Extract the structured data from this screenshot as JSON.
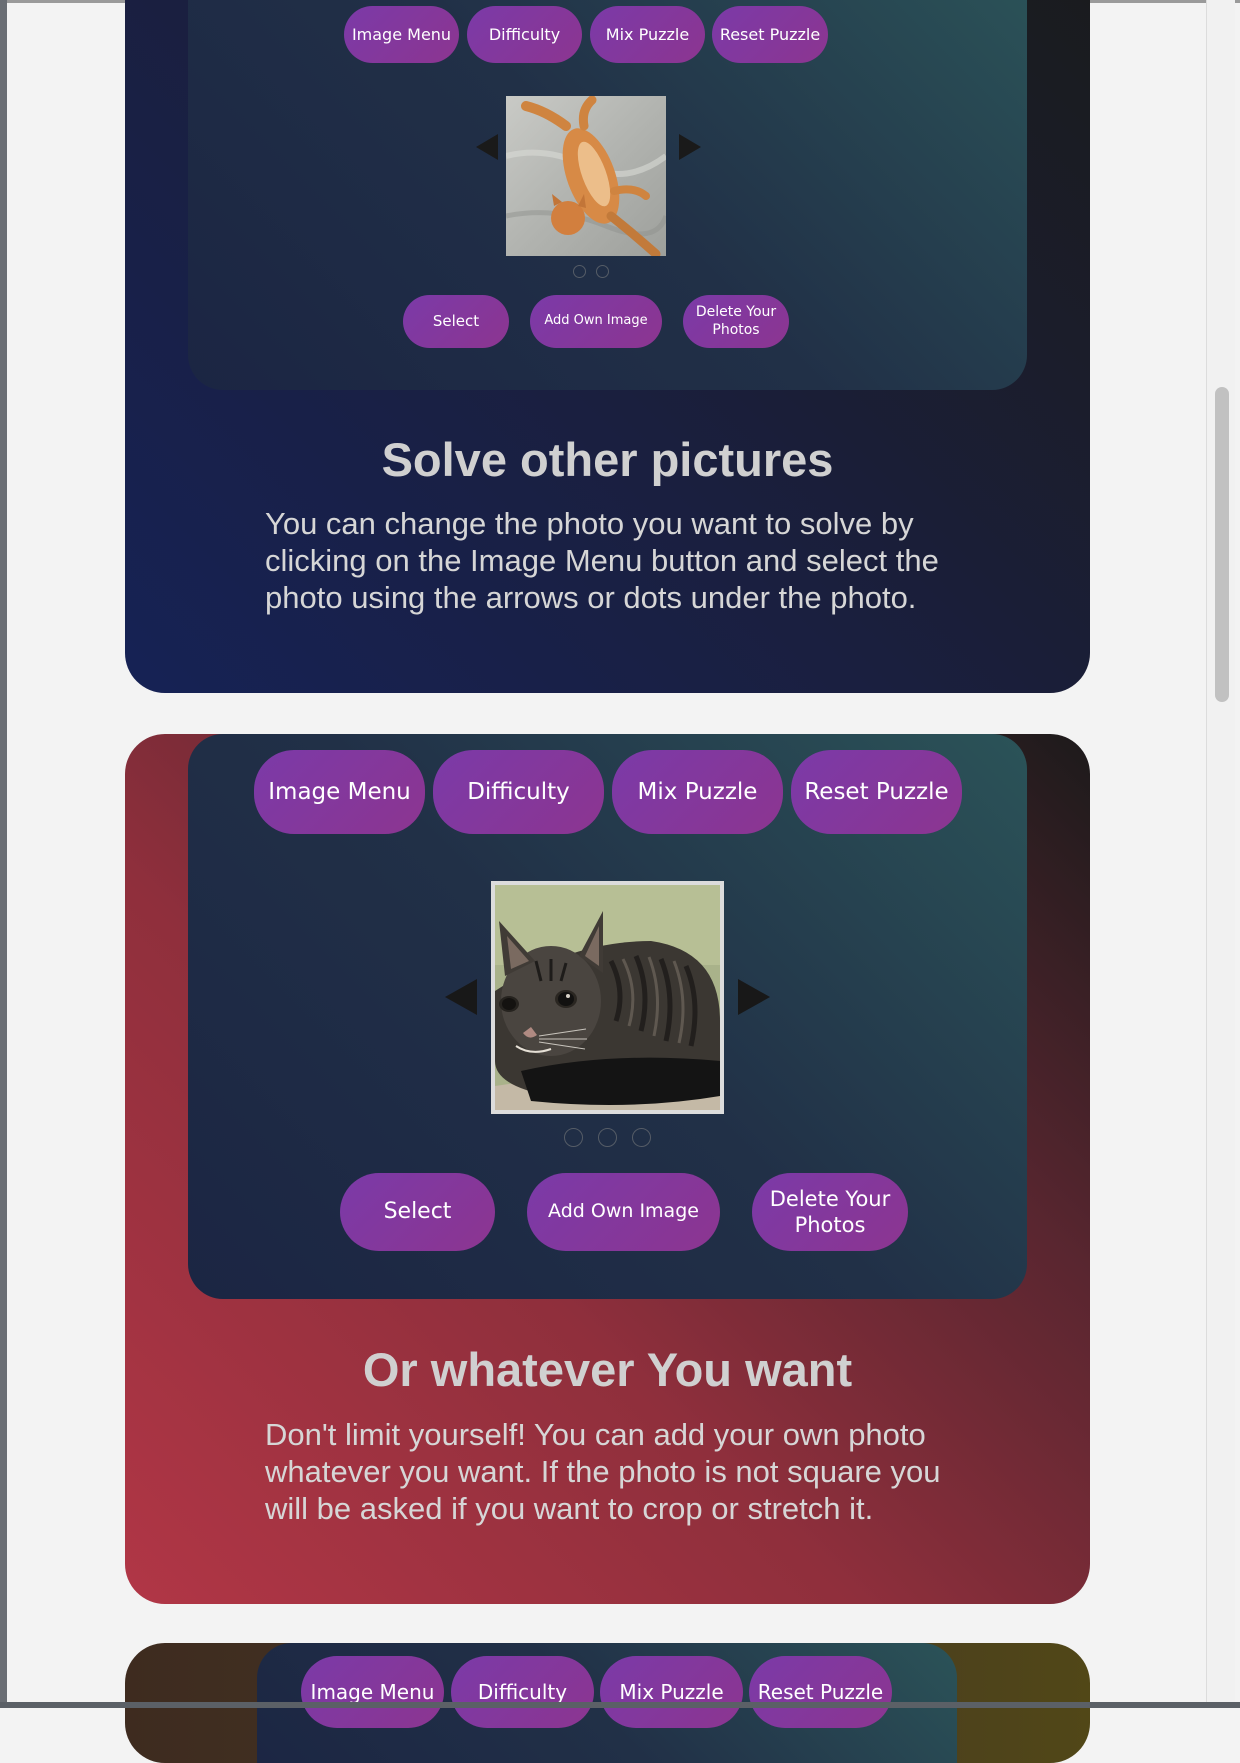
{
  "colors": {
    "page_background": "#f3f3f3",
    "button": "#8a3599",
    "heading_text": "#d0d0d0"
  },
  "toolbar": {
    "image_menu": "Image Menu",
    "difficulty": "Difficulty",
    "mix_puzzle": "Mix Puzzle",
    "reset_puzzle": "Reset Puzzle"
  },
  "image_menu": {
    "select": "Select",
    "add_own_image": "Add Own Image",
    "delete_line1": "Delete Your",
    "delete_line2": "Photos"
  },
  "sections": [
    {
      "title": "Solve other pictures",
      "text": "You can change the photo you want to solve by clicking on the Image Menu button and select the photo using the arrows or dots under the photo.",
      "photo": "orange cat lying on its back on a blanket",
      "dots": 2
    },
    {
      "title": "Or whatever You want",
      "text": "Don't limit yourself! You can add your own photo whatever you want. If the photo is not square you will be asked if you want to crop or stretch it.",
      "photo": "gray tabby cat lying down",
      "dots": 3
    }
  ],
  "icons": {
    "prev": "arrow-left-icon",
    "next": "arrow-right-icon"
  }
}
